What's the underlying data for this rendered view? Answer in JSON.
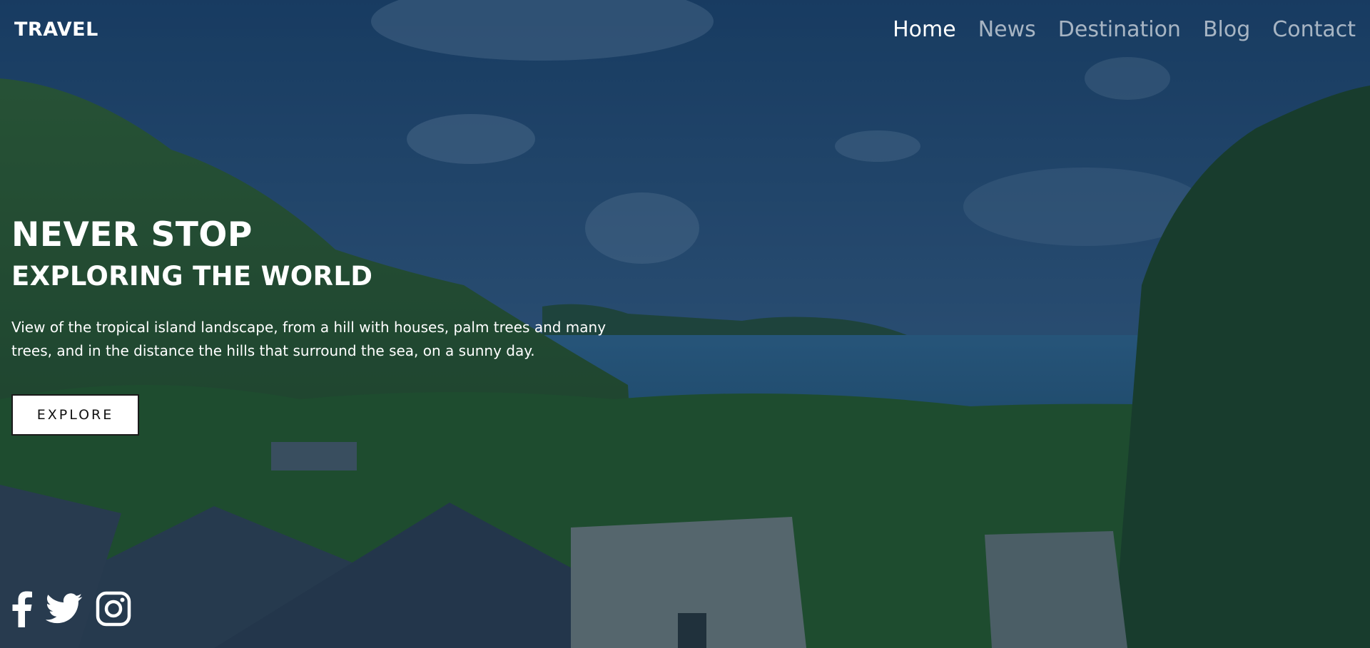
{
  "header": {
    "logo": "TRAVEL",
    "nav": [
      {
        "label": "Home",
        "active": true
      },
      {
        "label": "News",
        "active": false
      },
      {
        "label": "Destination",
        "active": false
      },
      {
        "label": "Blog",
        "active": false
      },
      {
        "label": "Contact",
        "active": false
      }
    ]
  },
  "hero": {
    "title": "NEVER STOP",
    "subtitle": "EXPLORING THE WORLD",
    "description": "View of the tropical island landscape, from a hill with houses, palm trees and many trees, and in the distance the hills that surround the sea, on a sunny day.",
    "button_label": "EXPLORE"
  },
  "social": [
    {
      "icon": "facebook-icon"
    },
    {
      "icon": "twitter-icon"
    },
    {
      "icon": "instagram-icon"
    }
  ],
  "colors": {
    "overlay": "#10284a",
    "sky": "#2c5a82",
    "forest": "#2f6a1f",
    "sea": "#2f6f93",
    "text": "#ffffff"
  }
}
